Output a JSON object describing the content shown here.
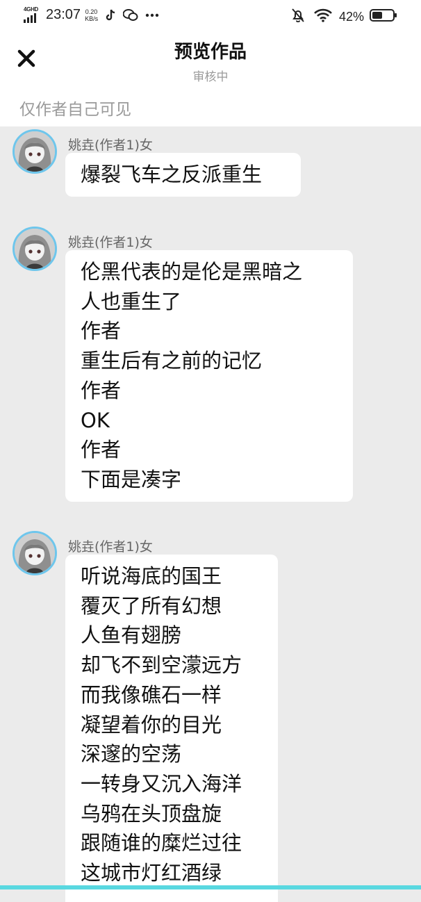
{
  "status_bar": {
    "network_type": "4GHD",
    "time": "23:07",
    "speed_value": "0.20",
    "speed_unit": "KB/s",
    "battery_percent": "42%"
  },
  "header": {
    "title": "预览作品",
    "subtitle": "审核中",
    "visibility_note": "仅作者自己可见"
  },
  "messages": [
    {
      "author": "姚垚(作者1)女",
      "lines": [
        "爆裂飞车之反派重生"
      ]
    },
    {
      "author": "姚垚(作者1)女",
      "lines": [
        "伦黑代表的是伦是黑暗之",
        "人也重生了",
        "作者",
        "重生后有之前的记忆",
        "作者",
        "OK",
        "作者",
        "下面是凑字"
      ]
    },
    {
      "author": "姚垚(作者1)女",
      "lines": [
        "听说海底的国王",
        "覆灭了所有幻想",
        "人鱼有翅膀",
        "却飞不到空濛远方",
        "而我像礁石一样",
        "凝望着你的目光",
        "深邃的空荡",
        "一转身又沉入海洋",
        "乌鸦在头顶盘旋",
        "跟随谁的糜烂过往",
        "这城市灯红酒绿"
      ]
    }
  ],
  "colors": {
    "avatar_ring": "#6ec6ec",
    "bubble": "#ffffff",
    "background": "#ebebeb",
    "bottom_accent": "#59d8e0"
  }
}
